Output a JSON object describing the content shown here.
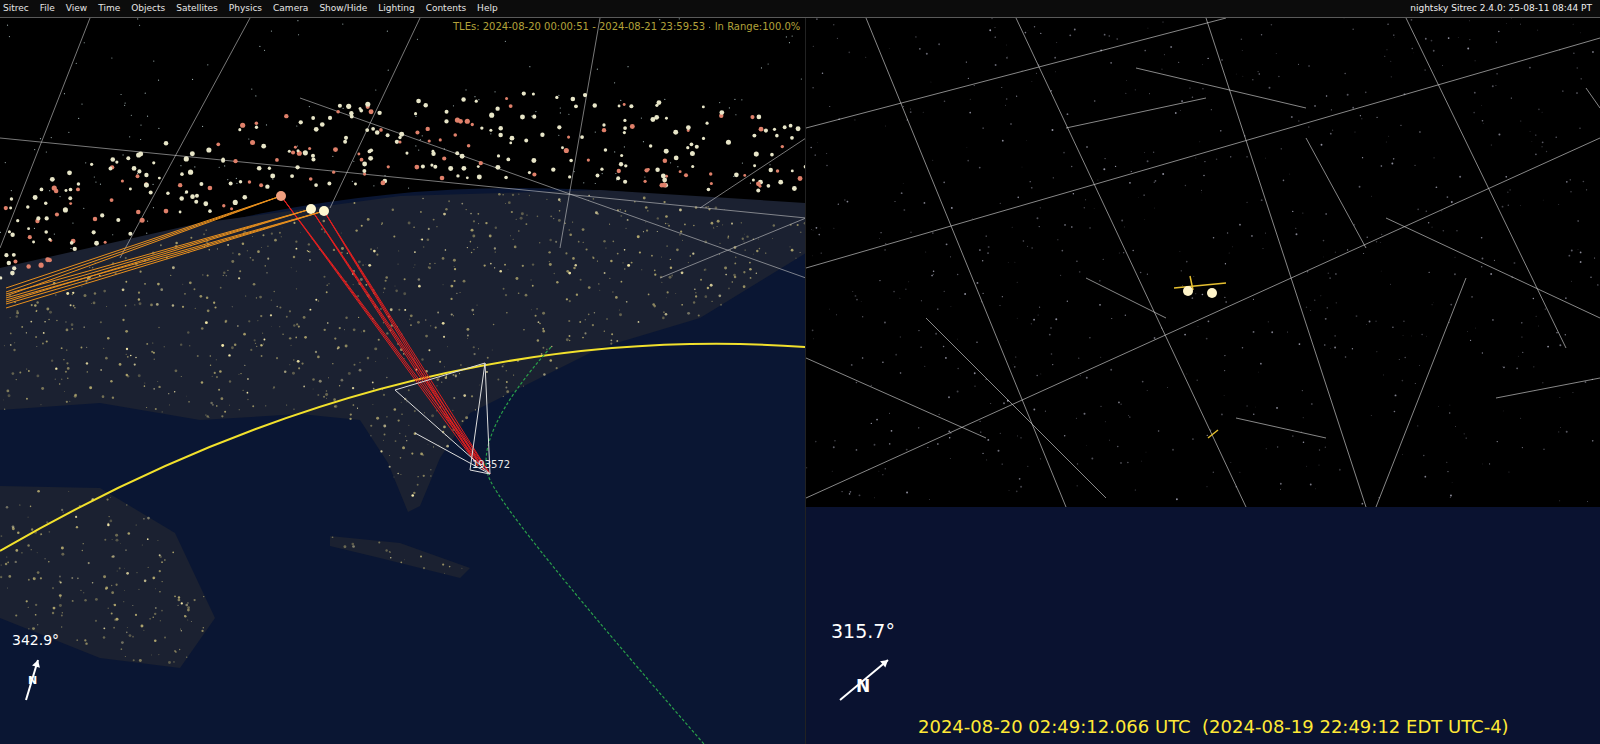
{
  "menu": {
    "items": [
      "Sitrec",
      "File",
      "View",
      "Time",
      "Objects",
      "Satellites",
      "Physics",
      "Camera",
      "Show/Hide",
      "Lighting",
      "Contents",
      "Help"
    ],
    "version": "nightsky Sitrec 2.4.0: 25-08-11 08:44 PT"
  },
  "main_view": {
    "tle_info": "TLEs: 2024-08-20 00:00:51 - 2024-08-21 23:59:53   In Range:100.0%",
    "target_label": "193572",
    "heading": "342.9°",
    "north": "N"
  },
  "look_view": {
    "heading": "315.7°",
    "north": "N",
    "time": "2024-08-20 02:49:12.066 UTC  (2024-08-19 22:49:12 EDT UTC-4)"
  }
}
